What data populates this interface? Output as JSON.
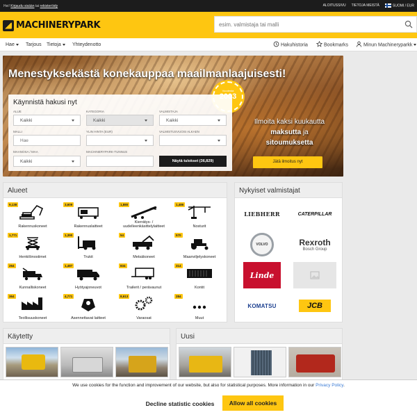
{
  "topbar": {
    "login_prefix": "Hei!",
    "login_link": "Kirjaudu sisään",
    "or": "tai",
    "register_link": "rekisteröidy",
    "links": [
      "ALOITUSSIVU",
      "TIETOJA MEISTÄ"
    ],
    "language": "SUOMI / EUR"
  },
  "header": {
    "logo_text": "MACHINERYPARK",
    "search_placeholder": "esim. valmistaja tai malli"
  },
  "nav": {
    "items": [
      "Hae",
      "Tarjous",
      "Tietoja",
      "Yhteydenotto"
    ],
    "right": [
      "Hakuhistoria",
      "Bookmarks",
      "Minun Machineryparkk"
    ]
  },
  "hero": {
    "headline": "Menestyksekästä konekauppaa maailmanlaajuisesti!",
    "badge_small": "Vuodesta",
    "badge_year": "2003",
    "form": {
      "title": "Käynnistä hakusi nyt",
      "labels": [
        "ALUE",
        "KATEGORIA",
        "VALMISTAJA",
        "MALLI",
        "YLIN HINTA (EUR)",
        "VALMISTUSVUOSI ALKAEN",
        "MAANOSA / MAA",
        "MACHINERYPARK-TUNNUS"
      ],
      "alue": "Kaikki",
      "kategoria": "Kaikki",
      "valmistaja": "Kaikki",
      "malli_placeholder": "Hae",
      "maa": "Kaikki",
      "show_button": "Näytä tulokset (36,829)"
    },
    "promo_line1": "Ilmoita kaksi kuukautta",
    "promo_bold1": "maksutta",
    "promo_ja": "ja",
    "promo_bold2": "sitoumuksetta",
    "promo_button": "Jätä ilmoitus nyt"
  },
  "alueet": {
    "title": "Alueet",
    "categories": [
      {
        "count": "9,138",
        "label": "Rakennuskoneet",
        "icon": "excavator-icon"
      },
      {
        "count": "3,609",
        "label": "Rakennuslaitteet",
        "icon": "generator-icon"
      },
      {
        "count": "1,880",
        "label": "Kierrätys- / uudelleenkäsittelylaitteet",
        "icon": "conveyor-icon"
      },
      {
        "count": "1,486",
        "label": "Nosturit",
        "icon": "crane-icon"
      },
      {
        "count": "1,771",
        "label": "Henkilönostimet",
        "icon": "scissor-lift-icon"
      },
      {
        "count": "1,390",
        "label": "Trukit",
        "icon": "forklift-icon"
      },
      {
        "count": "54",
        "label": "Metsäkoneet",
        "icon": "forestry-icon"
      },
      {
        "count": "570",
        "label": "Maanviljelyskoneet",
        "icon": "tractor-icon"
      },
      {
        "count": "264",
        "label": "Kunnalliskoneet",
        "icon": "municipal-icon"
      },
      {
        "count": "1,487",
        "label": "Hyötyajoneuvot",
        "icon": "truck-icon"
      },
      {
        "count": "834",
        "label": "Trailerit / perävaunut",
        "icon": "trailer-icon"
      },
      {
        "count": "314",
        "label": "Kontit",
        "icon": "container-icon"
      },
      {
        "count": "364",
        "label": "Teollisuuskoneet",
        "icon": "factory-icon"
      },
      {
        "count": "4,771",
        "label": "Asennettavat laitteet",
        "icon": "attachment-icon"
      },
      {
        "count": "8,613",
        "label": "Varaosat",
        "icon": "gears-icon"
      },
      {
        "count": "284",
        "label": "Muut",
        "icon": "more-icon"
      }
    ]
  },
  "brands": {
    "title": "Nykyiset valmistajat",
    "items": [
      "LIEBHERR",
      "CATERPILLAR",
      "VOLVO",
      "Rexroth",
      "Linde",
      "",
      "KOMATSU",
      "JCB"
    ],
    "rexroth_sub": "Bosch Group"
  },
  "kaytetty": {
    "title": "Käytetty"
  },
  "uusi": {
    "title": "Uusi"
  },
  "cookie": {
    "message": "We use cookies for the function and improvement of our website, but also for statistical purposes. More information in our",
    "policy_link": "Privacy Policy",
    "period": ".",
    "decline": "Decline statistic cookies",
    "allow": "Allow all cookies"
  },
  "colors": {
    "brand_yellow": "#fec611",
    "dark": "#1c1c1c",
    "link_blue": "#3a7bd5"
  }
}
